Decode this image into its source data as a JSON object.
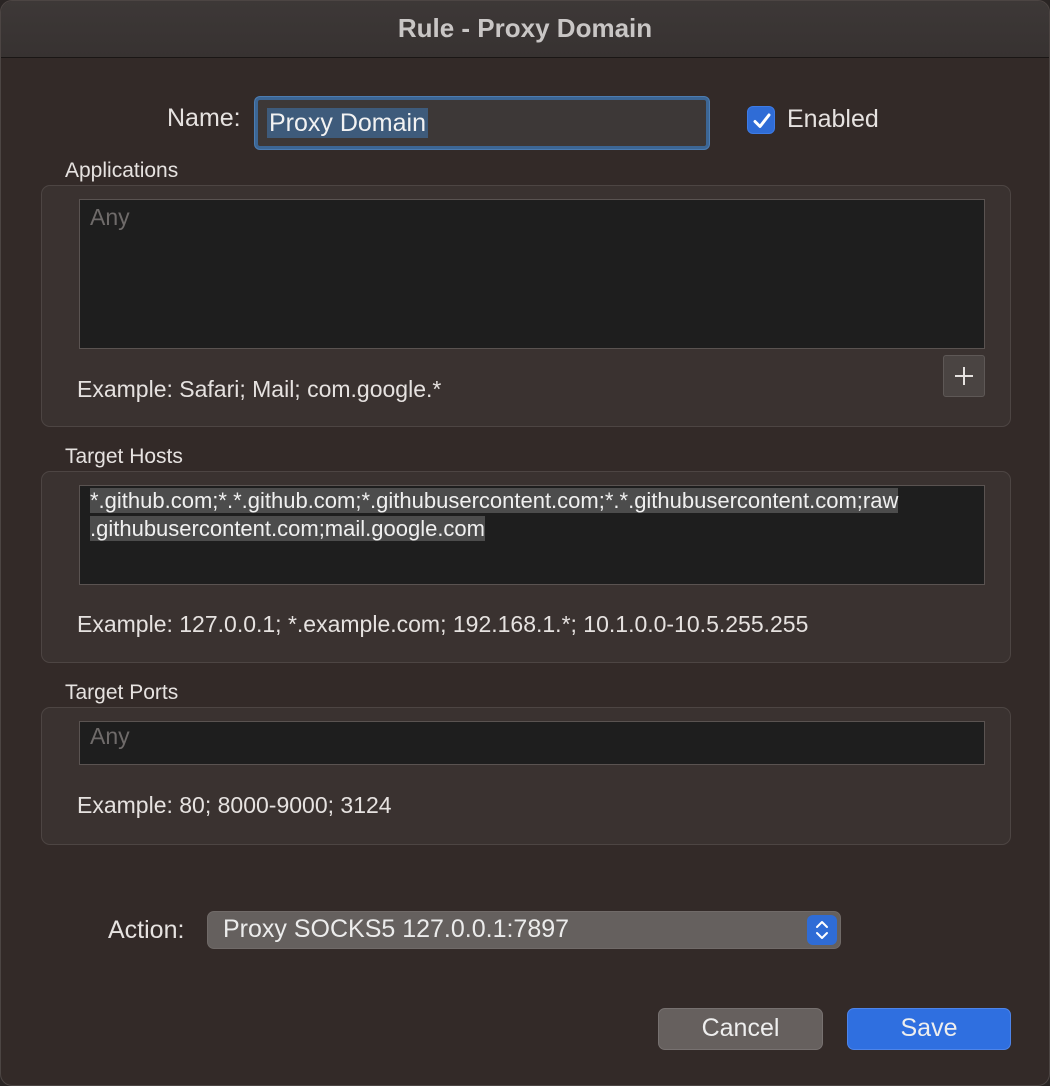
{
  "window": {
    "title": "Rule - Proxy Domain"
  },
  "name": {
    "label": "Name:",
    "value": "Proxy Domain"
  },
  "enabled": {
    "label": "Enabled",
    "checked": true,
    "accent": "#2f6cd6"
  },
  "applications": {
    "label": "Applications",
    "placeholder": "Any",
    "value": "",
    "add_button_icon": "plus-icon",
    "example": "Example: Safari; Mail; com.google.*"
  },
  "target_hosts": {
    "label": "Target Hosts",
    "lines": [
      "*.github.com;*.*.github.com;*.githubusercontent.com;*.*.githubusercontent.com;raw",
      ".githubusercontent.com;mail.google.com"
    ],
    "example": "Example: 127.0.0.1; *.example.com; 192.168.1.*; 10.1.0.0-10.5.255.255"
  },
  "target_ports": {
    "label": "Target Ports",
    "placeholder": "Any",
    "value": "",
    "example": "Example: 80; 8000-9000; 3124"
  },
  "action": {
    "label": "Action:",
    "selected": "Proxy SOCKS5 127.0.0.1:7897",
    "stepper_icon": "chevron-up-down-icon"
  },
  "buttons": {
    "cancel": "Cancel",
    "save": "Save",
    "save_color": "#2f6fe0"
  }
}
